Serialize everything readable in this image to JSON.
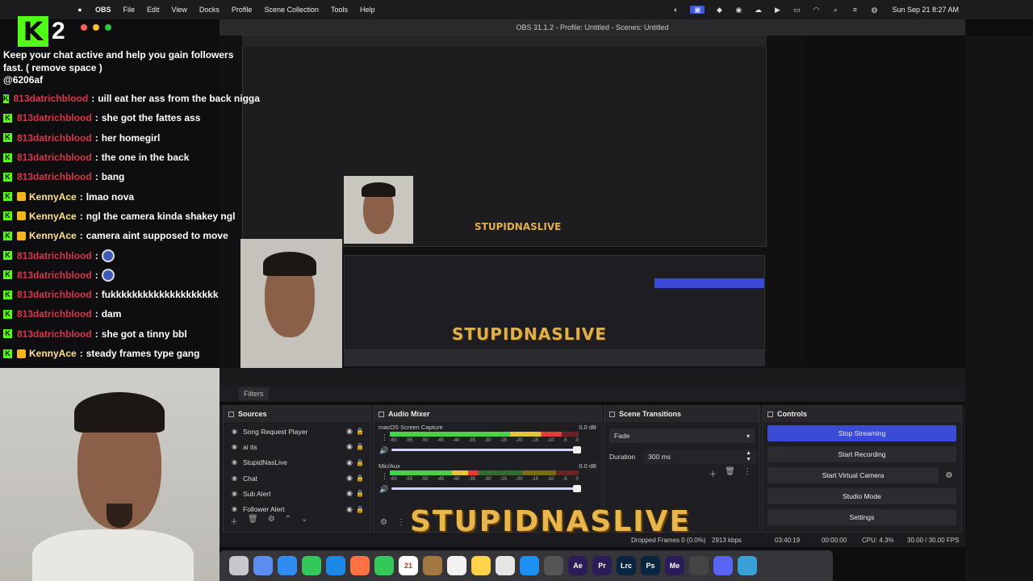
{
  "menubar": {
    "app_name": "OBS",
    "items": [
      "File",
      "Edit",
      "View",
      "Docks",
      "Profile",
      "Scene Collection",
      "Tools",
      "Help"
    ],
    "clock": "Sun Sep 21  8:27 AM"
  },
  "window": {
    "title": "OBS 31.1.2 - Profile: Untitled - Scenes: Untitled"
  },
  "kick": {
    "logo": "K",
    "viewer_count": "2"
  },
  "chat": {
    "promo": "Keep your chat active and help you gain followers fast. ( remove space )",
    "handle": "@6206af",
    "messages": [
      {
        "user": "813datrichblood",
        "color": "red",
        "text": "uill eat her ass from the back nigga",
        "badge": "kick"
      },
      {
        "user": "813datrichblood",
        "color": "red",
        "text": "she got the fattes ass",
        "badge": "kick"
      },
      {
        "user": "813datrichblood",
        "color": "red",
        "text": "her homegirl",
        "badge": "kick"
      },
      {
        "user": "813datrichblood",
        "color": "red",
        "text": "the one in the back",
        "badge": "kick"
      },
      {
        "user": "813datrichblood",
        "color": "red",
        "text": "bang",
        "badge": "kick"
      },
      {
        "user": "KennyAce",
        "color": "gold",
        "text": "lmao nova",
        "badge": "crown"
      },
      {
        "user": "KennyAce",
        "color": "gold",
        "text": "ngl the camera kinda shakey ngl",
        "badge": "crown"
      },
      {
        "user": "KennyAce",
        "color": "gold",
        "text": "camera aint supposed to move",
        "badge": "crown"
      },
      {
        "user": "813datrichblood",
        "color": "red",
        "text": "",
        "badge": "kick",
        "emote": true
      },
      {
        "user": "813datrichblood",
        "color": "red",
        "text": "",
        "badge": "kick",
        "emote": true
      },
      {
        "user": "813datrichblood",
        "color": "red",
        "text": "fukkkkkkkkkkkkkkkkkkkk",
        "badge": "kick"
      },
      {
        "user": "813datrichblood",
        "color": "red",
        "text": "dam",
        "badge": "kick"
      },
      {
        "user": "813datrichblood",
        "color": "red",
        "text": "she got a tinny bbl",
        "badge": "kick"
      },
      {
        "user": "KennyAce",
        "color": "gold",
        "text": "steady frames type gang",
        "badge": "crown"
      }
    ]
  },
  "filters_label": "Filters",
  "sources": {
    "title": "Sources",
    "items": [
      "Song Request Player",
      "ai its",
      "StupidNasLive",
      "Chat",
      "Sub Alert",
      "Follower Alert"
    ]
  },
  "mixer": {
    "title": "Audio Mixer",
    "channels": [
      {
        "name": "macOS Screen Capture",
        "db": "0.0 dB",
        "level": 0.91
      },
      {
        "name": "Mic/Aux",
        "db": "0.0 dB",
        "level": 0.47
      }
    ],
    "ticks": [
      "-60",
      "-55",
      "-50",
      "-45",
      "-40",
      "-35",
      "-30",
      "-25",
      "-20",
      "-15",
      "-10",
      "-5",
      "0"
    ]
  },
  "transitions": {
    "title": "Scene Transitions",
    "selected": "Fade",
    "duration_label": "Duration",
    "duration_value": "300 ms"
  },
  "controls": {
    "title": "Controls",
    "buttons": [
      "Stop Streaming",
      "Start Recording",
      "Start Virtual Camera",
      "Studio Mode",
      "Settings"
    ]
  },
  "status": {
    "dropped": "Dropped Frames 0 (0.0%)",
    "bitrate": "2913 kbps",
    "stream_time": "03:40:19",
    "rec_time": "00:00:00",
    "cpu": "CPU: 4.3%",
    "fps": "30.00 / 30.00 FPS"
  },
  "overlay_logo": "STUPIDNASLIVE",
  "dock_apps": [
    {
      "label": "",
      "color": "#c7c7cc"
    },
    {
      "label": "",
      "color": "#5b8def"
    },
    {
      "label": "",
      "color": "#2f8cf0"
    },
    {
      "label": "",
      "color": "#34c759"
    },
    {
      "label": "",
      "color": "#1e88e5"
    },
    {
      "label": "",
      "color": "#ff7043"
    },
    {
      "label": "",
      "color": "#34c759"
    },
    {
      "label": "21",
      "color": "#ffffff"
    },
    {
      "label": "",
      "color": "#a27840"
    },
    {
      "label": "",
      "color": "#f2f2f2"
    },
    {
      "label": "",
      "color": "#ffd24a"
    },
    {
      "label": "",
      "color": "#e6e6e6"
    },
    {
      "label": "",
      "color": "#1f8ef1"
    },
    {
      "label": "",
      "color": "#555"
    },
    {
      "label": "Ae",
      "color": "#2b1b58"
    },
    {
      "label": "Pr",
      "color": "#2b1b58"
    },
    {
      "label": "Lrc",
      "color": "#0a2540"
    },
    {
      "label": "Ps",
      "color": "#0a2540"
    },
    {
      "label": "Me",
      "color": "#2b1b58"
    },
    {
      "label": "",
      "color": "#444"
    },
    {
      "label": "",
      "color": "#5865f2"
    },
    {
      "label": "",
      "color": "#3aa0d8"
    }
  ]
}
